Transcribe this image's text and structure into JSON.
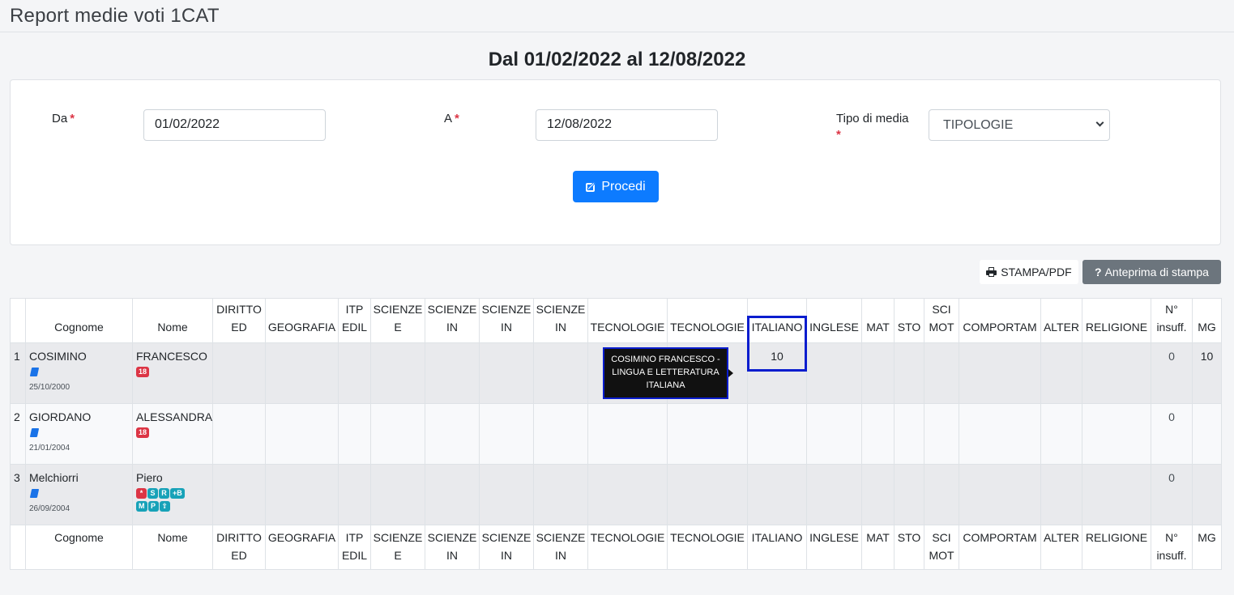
{
  "header": {
    "title": "Report medie voti 1CAT"
  },
  "range_title": "Dal 01/02/2022 al 12/08/2022",
  "form": {
    "da_label": "Da",
    "a_label": "A",
    "tipo_label": "Tipo di media",
    "required_mark": "*",
    "da_value": "01/02/2022",
    "a_value": "12/08/2022",
    "tipo_value": "TIPOLOGIE",
    "procedi_label": "Procedi"
  },
  "toolbar": {
    "stampa_label": "STAMPA/PDF",
    "anteprima_label": "Anteprima di stampa"
  },
  "table": {
    "columns": [
      "",
      "Cognome",
      "Nome",
      "DIRITTO ED",
      "GEOGRAFIA",
      "ITP EDIL",
      "SCIENZE E",
      "SCIENZE IN",
      "SCIENZE IN",
      "SCIENZE IN",
      "TECNOLOGIE",
      "TECNOLOGIE",
      "ITALIANO",
      "INGLESE",
      "MAT",
      "STO",
      "SCI MOT",
      "COMPORTAM",
      "ALTER",
      "RELIGIONE",
      "N° insuff.",
      "MG"
    ],
    "rows": [
      {
        "num": "1",
        "cognome": "COSIMINO",
        "nome": "FRANCESCO",
        "dob": "25/10/2000",
        "badges": [
          {
            "text": "18",
            "color": "#dc3545"
          }
        ],
        "italiano": "10",
        "insuff": "0",
        "mg": "10"
      },
      {
        "num": "2",
        "cognome": "GIORDANO",
        "nome": "ALESSANDRA",
        "dob": "21/01/2004",
        "badges": [
          {
            "text": "18",
            "color": "#dc3545"
          }
        ],
        "italiano": "",
        "insuff": "0",
        "mg": ""
      },
      {
        "num": "3",
        "cognome": "Melchiorri",
        "nome": "Piero",
        "dob": "26/09/2004",
        "badges": [
          {
            "text": "*",
            "color": "#dc3545"
          },
          {
            "text": "S",
            "color": "#17a2b8"
          },
          {
            "text": "R",
            "color": "#17a2b8"
          },
          {
            "text": "+B",
            "color": "#17a2b8"
          },
          {
            "text": "M",
            "color": "#17a2b8"
          },
          {
            "text": "P",
            "color": "#17a2b8"
          },
          {
            "text": "⇪",
            "color": "#17a2b8"
          }
        ],
        "italiano": "",
        "insuff": "0",
        "mg": ""
      }
    ],
    "tooltip": "COSIMINO FRANCESCO - LINGUA E LETTERATURA ITALIANA"
  },
  "colors": {
    "primary": "#0d7bff",
    "secondary": "#6c757d",
    "danger": "#dc3545",
    "info": "#17a2b8",
    "highlight": "#0a1dce"
  },
  "icons": {
    "procedi": "edit-icon",
    "stampa": "printer-icon",
    "anteprima": "question-icon",
    "registro": "book-icon",
    "select": "chevron-down-icon"
  }
}
